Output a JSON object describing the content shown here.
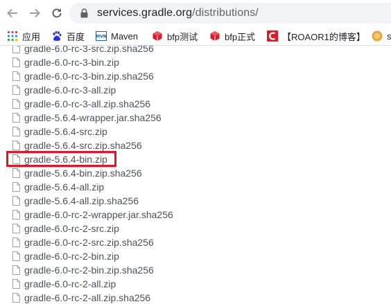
{
  "toolbar": {
    "url_host": "services.gradle.org",
    "url_path": "/distributions/"
  },
  "bookmarks": [
    {
      "label": "应用",
      "icon": "apps-grid-icon"
    },
    {
      "label": "百度",
      "icon": "baidu-paw-icon"
    },
    {
      "label": "Maven",
      "icon": "mvn-logo-icon"
    },
    {
      "label": "bfp测试",
      "icon": "bfp-cube-icon"
    },
    {
      "label": "bfp正式",
      "icon": "bfp-cube-icon"
    },
    {
      "label": "【ROAOR1的博客】",
      "icon": "csdn-c-icon"
    },
    {
      "label": "s",
      "icon": "coin-icon"
    }
  ],
  "files": [
    "gradle-6.0-rc-3-src.zip.sha256",
    "gradle-6.0-rc-3-bin.zip",
    "gradle-6.0-rc-3-bin.zip.sha256",
    "gradle-6.0-rc-3-all.zip",
    "gradle-6.0-rc-3-all.zip.sha256",
    "gradle-5.6.4-wrapper.jar.sha256",
    "gradle-5.6.4-src.zip",
    "gradle-5.6.4-src.zip.sha256",
    "gradle-5.6.4-bin.zip",
    "gradle-5.6.4-bin.zip.sha256",
    "gradle-5.6.4-all.zip",
    "gradle-5.6.4-all.zip.sha256",
    "gradle-6.0-rc-2-wrapper.jar.sha256",
    "gradle-6.0-rc-2-src.zip",
    "gradle-6.0-rc-2-src.zip.sha256",
    "gradle-6.0-rc-2-bin.zip",
    "gradle-6.0-rc-2-bin.zip.sha256",
    "gradle-6.0-rc-2-all.zip",
    "gradle-6.0-rc-2-all.zip.sha256"
  ],
  "highlighted_file": "gradle-5.6.4-bin.zip",
  "colors": {
    "highlight_border": "#e0142a",
    "file_text": "#4d5157",
    "omnibox_bg": "#f1f3f4"
  }
}
